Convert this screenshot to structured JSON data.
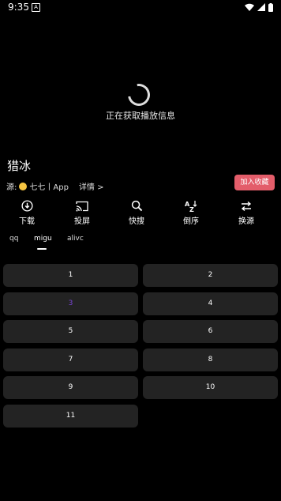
{
  "status_bar": {
    "time": "9:35",
    "notification_icon": "a-icon",
    "wifi_icon": "wifi-icon",
    "signal_icon": "signal-icon",
    "battery_icon": "battery-icon"
  },
  "player": {
    "loading_text": "正在获取播放信息"
  },
  "video": {
    "title": "猎冰",
    "source_prefix": "源:",
    "source_name": "七七丨App",
    "details_link": "详情 >",
    "favorite_button": "加入收藏"
  },
  "actions": [
    {
      "label": "下载",
      "icon": "download-icon"
    },
    {
      "label": "投屏",
      "icon": "cast-icon"
    },
    {
      "label": "快搜",
      "icon": "search-icon"
    },
    {
      "label": "倒序",
      "icon": "sort-az-icon"
    },
    {
      "label": "换源",
      "icon": "swap-icon"
    }
  ],
  "source_tabs": [
    {
      "label": "qq",
      "active": false
    },
    {
      "label": "migu",
      "active": true
    },
    {
      "label": "alivc",
      "active": false
    }
  ],
  "episodes": [
    {
      "label": "1",
      "active": false
    },
    {
      "label": "2",
      "active": false
    },
    {
      "label": "3",
      "active": true
    },
    {
      "label": "4",
      "active": false
    },
    {
      "label": "5",
      "active": false
    },
    {
      "label": "6",
      "active": false
    },
    {
      "label": "7",
      "active": false
    },
    {
      "label": "8",
      "active": false
    },
    {
      "label": "9",
      "active": false
    },
    {
      "label": "10",
      "active": false
    },
    {
      "label": "11",
      "active": false
    }
  ],
  "colors": {
    "background": "#000000",
    "episode_bg": "#232323",
    "active_episode_text": "#7a45d6",
    "favorite_button_bg": "#e35d6a"
  }
}
